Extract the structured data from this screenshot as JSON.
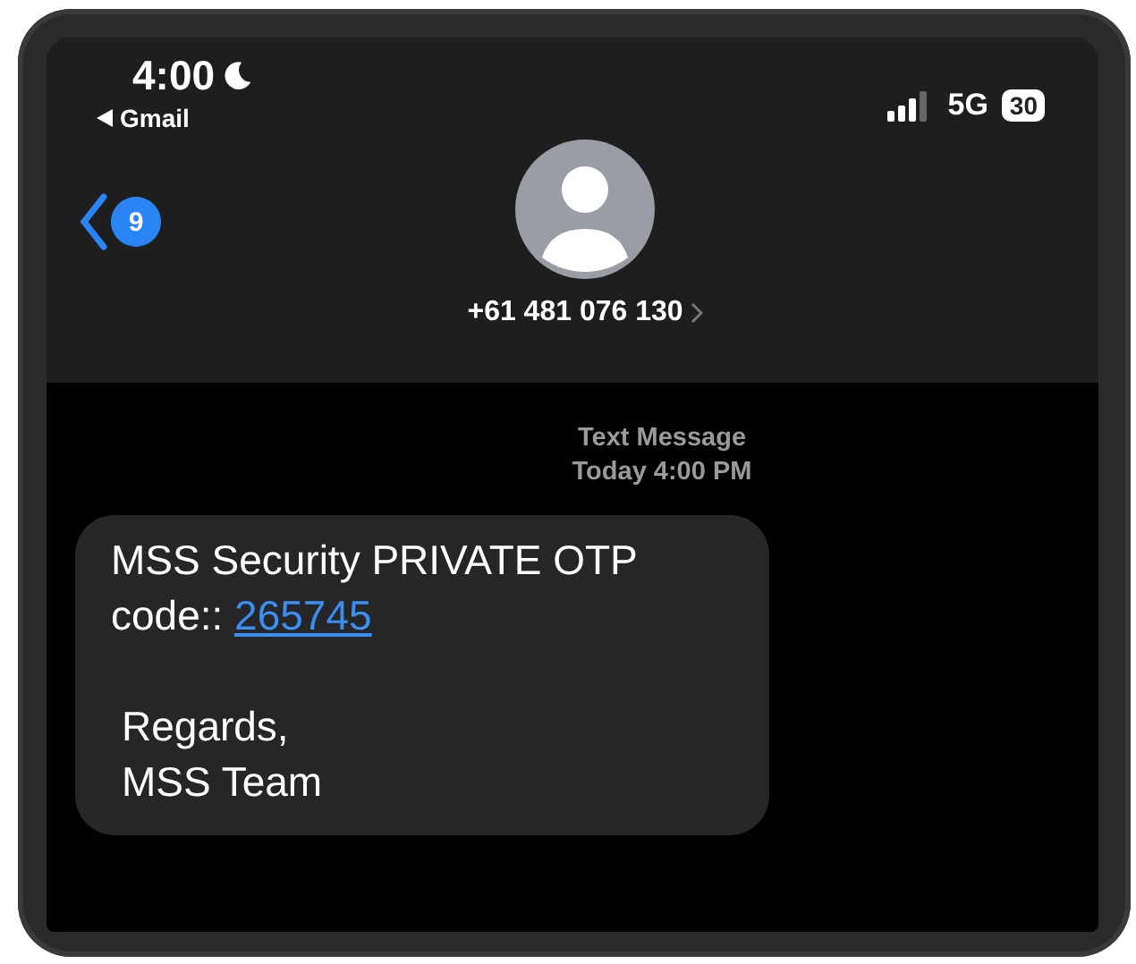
{
  "status_bar": {
    "time": "4:00",
    "back_app": "Gmail",
    "network": "5G",
    "battery": "30"
  },
  "header": {
    "unread_count": "9",
    "contact": "+61 481 076 130"
  },
  "thread": {
    "service": "Text Message",
    "timestamp": "Today 4:00 PM"
  },
  "message": {
    "text": "MSS Security PRIVATE OTP code::",
    "code": "265745",
    "signoff": [
      "Regards,",
      "MSS Team"
    ]
  }
}
